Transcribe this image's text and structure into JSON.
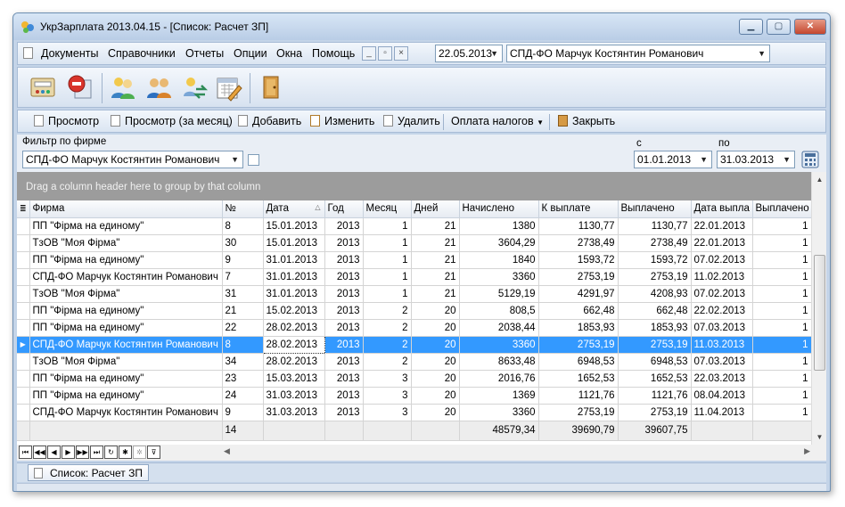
{
  "window": {
    "title": "УкрЗарплата 2013.04.15 - [Список: Расчет ЗП]"
  },
  "menu": {
    "items": [
      "Документы",
      "Справочники",
      "Отчеты",
      "Опции",
      "Окна",
      "Помощь"
    ],
    "date": "22.05.2013",
    "firm": "СПД-ФО Марчук Костянтин Романович"
  },
  "toolbar_icons": [
    "calculator-icon",
    "stop-icon",
    "users-icon",
    "people-icon",
    "transfer-icon",
    "calendar-icon",
    "exit-icon"
  ],
  "actions": {
    "view": "Просмотр",
    "view_month": "Просмотр (за месяц)",
    "add": "Добавить",
    "edit": "Изменить",
    "delete": "Удалить",
    "taxes": "Оплата налогов",
    "close": "Закрыть"
  },
  "filter": {
    "label": "Фильтр по фирме",
    "firm": "СПД-ФО Марчук Костянтин Романович",
    "from_label": "с",
    "from": "01.01.2013",
    "to_label": "по",
    "to": "31.03.2013"
  },
  "group_hint": "Drag a column header here to group by that column",
  "grid": {
    "columns": [
      "Фирма",
      "№",
      "Дата",
      "Год",
      "Месяц",
      "Дней",
      "Начислено",
      "К выплате",
      "Выплачено",
      "Дата выпла",
      "Выплачено п"
    ],
    "rows": [
      [
        "ПП \"Фірма на единому\"",
        "8",
        "15.01.2013",
        "2013",
        "1",
        "21",
        "1380",
        "1130,77",
        "1130,77",
        "22.01.2013",
        "1"
      ],
      [
        "ТзОВ \"Моя Фірма\"",
        "30",
        "15.01.2013",
        "2013",
        "1",
        "21",
        "3604,29",
        "2738,49",
        "2738,49",
        "22.01.2013",
        "1"
      ],
      [
        "ПП \"Фірма на единому\"",
        "9",
        "31.01.2013",
        "2013",
        "1",
        "21",
        "1840",
        "1593,72",
        "1593,72",
        "07.02.2013",
        "1"
      ],
      [
        "СПД-ФО Марчук Костянтин Романович",
        "7",
        "31.01.2013",
        "2013",
        "1",
        "21",
        "3360",
        "2753,19",
        "2753,19",
        "11.02.2013",
        "1"
      ],
      [
        "ТзОВ \"Моя Фірма\"",
        "31",
        "31.01.2013",
        "2013",
        "1",
        "21",
        "5129,19",
        "4291,97",
        "4208,93",
        "07.02.2013",
        "1"
      ],
      [
        "ПП \"Фірма на единому\"",
        "21",
        "15.02.2013",
        "2013",
        "2",
        "20",
        "808,5",
        "662,48",
        "662,48",
        "22.02.2013",
        "1"
      ],
      [
        "ПП \"Фірма на единому\"",
        "22",
        "28.02.2013",
        "2013",
        "2",
        "20",
        "2038,44",
        "1853,93",
        "1853,93",
        "07.03.2013",
        "1"
      ],
      [
        "СПД-ФО Марчук Костянтин Романович",
        "8",
        "28.02.2013",
        "2013",
        "2",
        "20",
        "3360",
        "2753,19",
        "2753,19",
        "11.03.2013",
        "1"
      ],
      [
        "ТзОВ \"Моя Фірма\"",
        "34",
        "28.02.2013",
        "2013",
        "2",
        "20",
        "8633,48",
        "6948,53",
        "6948,53",
        "07.03.2013",
        "1"
      ],
      [
        "ПП \"Фірма на единому\"",
        "23",
        "15.03.2013",
        "2013",
        "3",
        "20",
        "2016,76",
        "1652,53",
        "1652,53",
        "22.03.2013",
        "1"
      ],
      [
        "ПП \"Фірма на единому\"",
        "24",
        "31.03.2013",
        "2013",
        "3",
        "20",
        "1369",
        "1121,76",
        "1121,76",
        "08.04.2013",
        "1"
      ],
      [
        "СПД-ФО Марчук Костянтин Романович",
        "9",
        "31.03.2013",
        "2013",
        "3",
        "20",
        "3360",
        "2753,19",
        "2753,19",
        "11.04.2013",
        "1"
      ]
    ],
    "selected_row": 7,
    "footer": {
      "count": "14",
      "accrued": "48579,34",
      "to_pay": "39690,79",
      "paid": "39607,75"
    }
  },
  "tab": {
    "label": "Список: Расчет ЗП"
  },
  "colors": {
    "selection": "#3399ff",
    "group_panel": "#9c9c9c",
    "window_frame": "#c4d4e8"
  }
}
